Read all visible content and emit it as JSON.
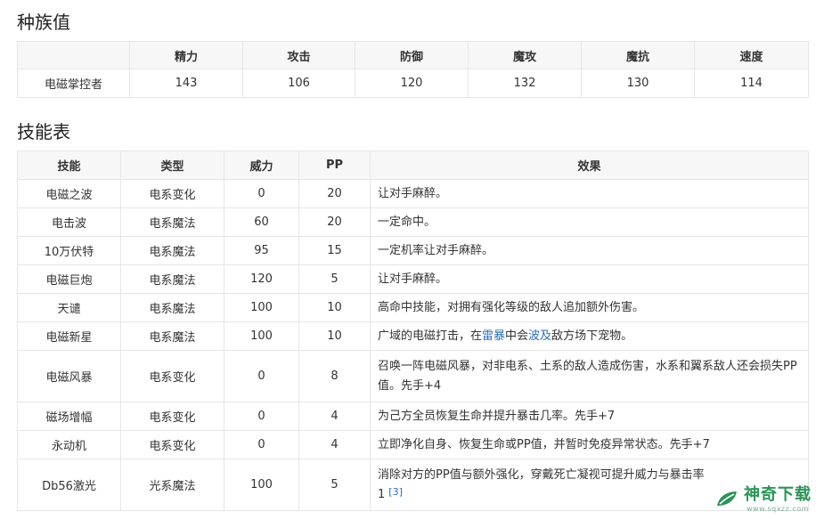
{
  "stats_section": {
    "title": "种族值",
    "headers": [
      "",
      "精力",
      "攻击",
      "防御",
      "魔攻",
      "魔抗",
      "速度"
    ],
    "row": [
      "电磁掌控者",
      "143",
      "106",
      "120",
      "132",
      "130",
      "114"
    ]
  },
  "skills_section": {
    "title": "技能表",
    "headers": [
      "技能",
      "类型",
      "威力",
      "PP",
      "效果"
    ],
    "rows": [
      {
        "name": "电磁之波",
        "type": "电系变化",
        "power": "0",
        "pp": "20",
        "effect": "让对手麻醉。"
      },
      {
        "name": "电击波",
        "type": "电系魔法",
        "power": "60",
        "pp": "20",
        "effect": "一定命中。"
      },
      {
        "name": "10万伏特",
        "type": "电系魔法",
        "power": "95",
        "pp": "15",
        "effect": "一定机率让对手麻醉。"
      },
      {
        "name": "电磁巨炮",
        "type": "电系魔法",
        "power": "120",
        "pp": "5",
        "effect": "让对手麻醉。"
      },
      {
        "name": "天谴",
        "type": "电系魔法",
        "power": "100",
        "pp": "10",
        "effect": "高命中技能，对拥有强化等级的敌人追加额外伤害。"
      },
      {
        "name": "电磁新星",
        "type": "电系魔法",
        "power": "100",
        "pp": "10",
        "effect_a": "广域的电磁打击，在",
        "effect_link1": "雷暴",
        "effect_b": "中会",
        "effect_link2": "波及",
        "effect_c": "敌方场下宠物。"
      },
      {
        "name": "电磁风暴",
        "type": "电系变化",
        "power": "0",
        "pp": "8",
        "effect": "召唤一阵电磁风暴，对非电系、土系的敌人造成伤害，水系和翼系敌人还会损失PP值。先手+4"
      },
      {
        "name": "磁场增幅",
        "type": "电系变化",
        "power": "0",
        "pp": "4",
        "effect": "为己方全员恢复生命并提升暴击几率。先手+7"
      },
      {
        "name": "永动机",
        "type": "电系变化",
        "power": "0",
        "pp": "4",
        "effect": "立即净化自身、恢复生命或PP值，并暂时免疫异常状态。先手+7"
      },
      {
        "name": "Db56激光",
        "type": "光系魔法",
        "power": "100",
        "pp": "5",
        "effect": "消除对方的PP值与额外强化，穿戴死亡凝视可提升威力与暴击率",
        "effect_line2": "1",
        "ref": "[3]"
      }
    ]
  },
  "watermark": {
    "main": "神奇下载",
    "sub": "www.sqxzz.com"
  }
}
